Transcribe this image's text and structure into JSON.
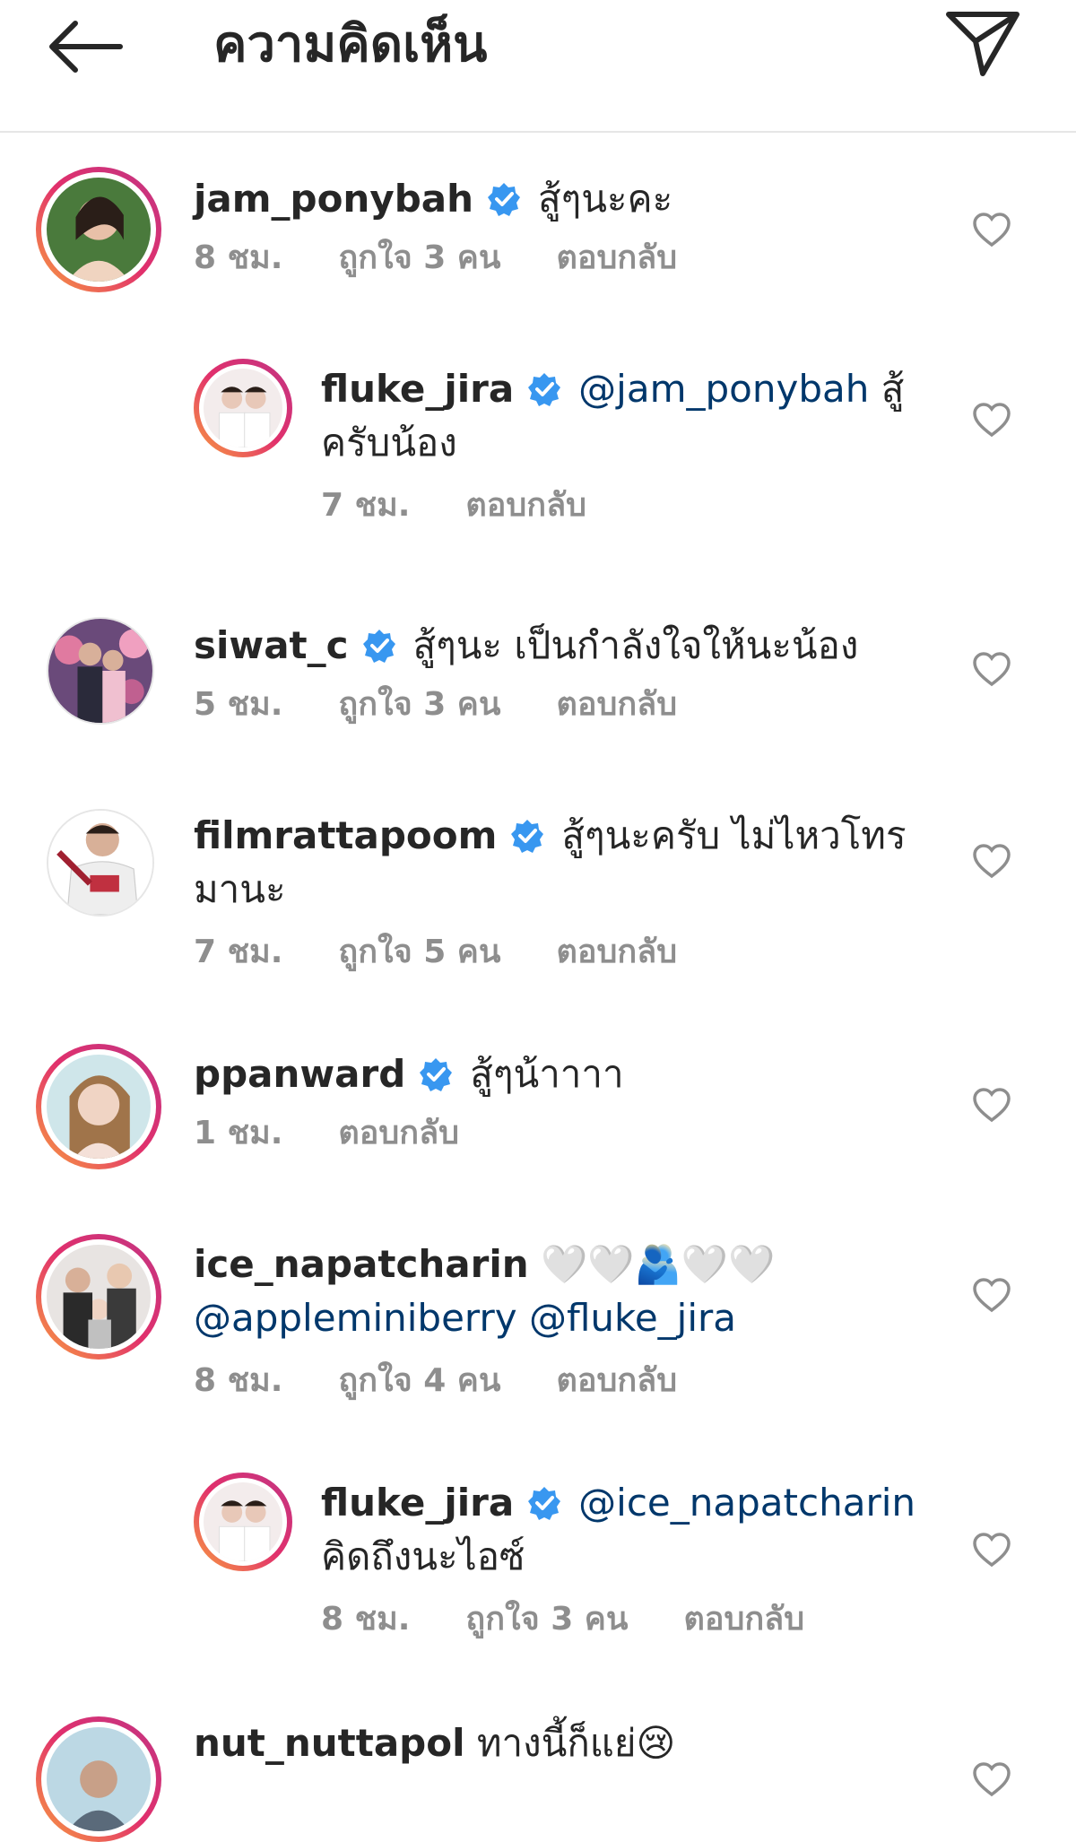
{
  "header": {
    "title": "ความคิดเห็น"
  },
  "comments": [
    {
      "username": "jam_ponybah",
      "text": "สู้ๆนะคะ",
      "time": "8 ชม.",
      "likes": "ถูกใจ 3 คน",
      "reply": "ตอบกลับ"
    },
    {
      "username": "fluke_jira",
      "mention": "@jam_ponybah",
      "text": "สู้",
      "text2": "ครับน้อง",
      "time": "7 ชม.",
      "reply": "ตอบกลับ"
    },
    {
      "username": "siwat_c",
      "text": "สู้ๆนะ เป็นกำลังใจให้นะน้อง",
      "time": "5 ชม.",
      "likes": "ถูกใจ 3 คน",
      "reply": "ตอบกลับ"
    },
    {
      "username": "filmrattapoom",
      "text": "สู้ๆนะครับ ไม่ไหวโทร",
      "text2": "มานะ",
      "time": "7 ชม.",
      "likes": "ถูกใจ 5 คน",
      "reply": "ตอบกลับ"
    },
    {
      "username": "ppanward",
      "text": "สู้ๆน้าาาา",
      "time": "1 ชม.",
      "reply": "ตอบกลับ"
    },
    {
      "username": "ice_napatcharin",
      "text": "🤍🤍🫂🤍🤍",
      "mention2": "@appleminiberry @fluke_jira",
      "time": "8 ชม.",
      "likes": "ถูกใจ 4 คน",
      "reply": "ตอบกลับ"
    },
    {
      "username": "fluke_jira",
      "mention": "@ice_napatcharin",
      "text2": "คิดถึงนะไอซ์",
      "time": "8 ชม.",
      "likes": "ถูกใจ 3 คน",
      "reply": "ตอบกลับ"
    },
    {
      "username": "nut_nuttapol",
      "text": "ทางนี้ก็แย่😢"
    }
  ]
}
